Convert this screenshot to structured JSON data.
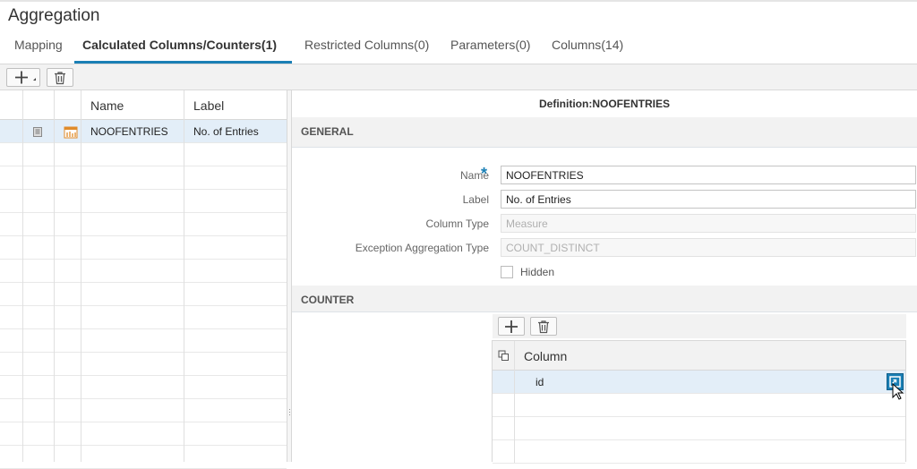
{
  "page": {
    "title": "Aggregation"
  },
  "tabs": [
    {
      "label": "Mapping"
    },
    {
      "label": "Calculated Columns/Counters(1)"
    },
    {
      "label": "Restricted Columns(0)"
    },
    {
      "label": "Parameters(0)"
    },
    {
      "label": "Columns(14)"
    }
  ],
  "left_table": {
    "headers": {
      "name": "Name",
      "label": "Label"
    },
    "rows": [
      {
        "name": "NOOFENTRIES",
        "label": "No. of Entries"
      }
    ]
  },
  "definition": {
    "title": "Definition:NOOFENTRIES",
    "general_section": "GENERAL",
    "fields": {
      "name_label": "Name",
      "name_value": "NOOFENTRIES",
      "label_label": "Label",
      "label_value": "No. of Entries",
      "column_type_label": "Column Type",
      "column_type_value": "Measure",
      "exception_label": "Exception Aggregation Type",
      "exception_value": "COUNT_DISTINCT",
      "hidden_label": "Hidden"
    },
    "counter_section": "COUNTER",
    "counter_table": {
      "header": "Column",
      "rows": [
        {
          "column": "id"
        }
      ]
    }
  },
  "colors": {
    "accent": "#1a7fb5",
    "selected_row": "#e3eef8",
    "section_bg": "#f2f2f2"
  }
}
